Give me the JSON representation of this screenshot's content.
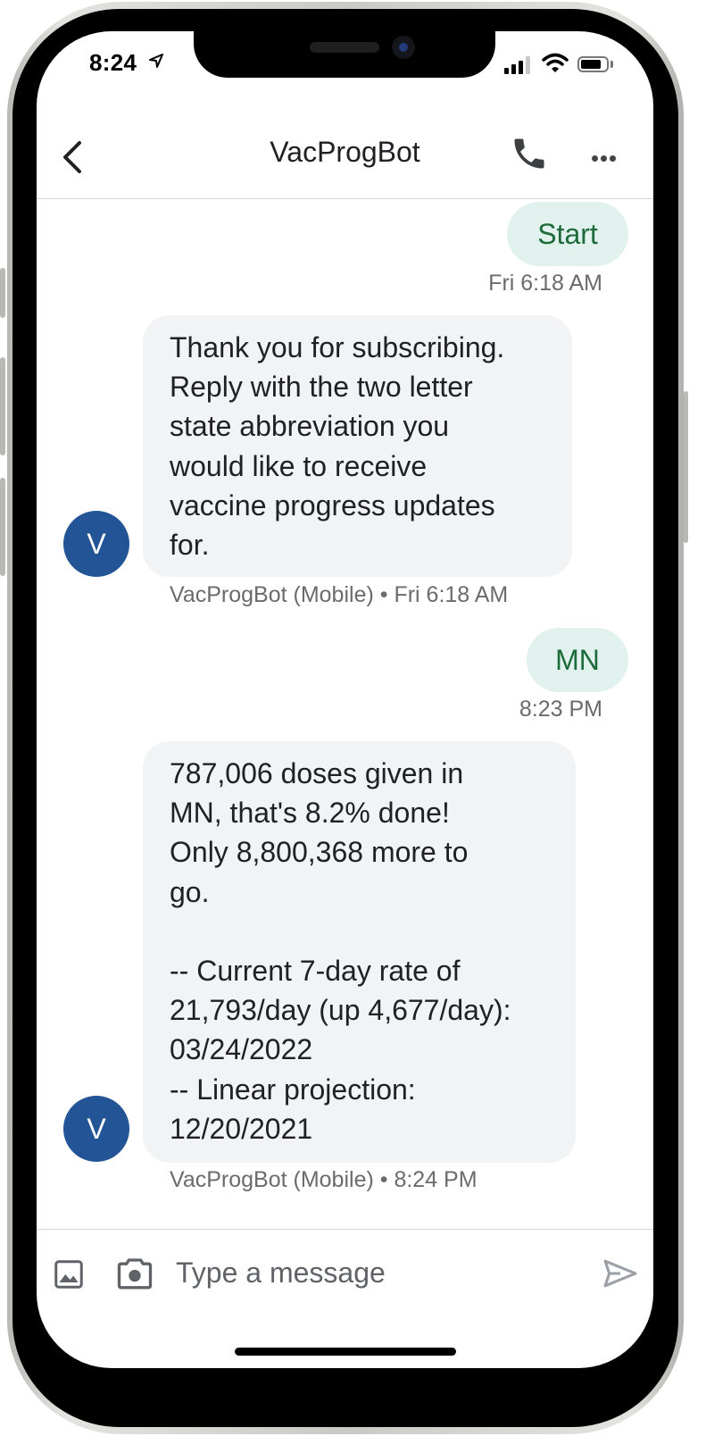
{
  "status_bar": {
    "time": "8:24"
  },
  "header": {
    "title": "VacProgBot",
    "back_icon": "chevron-left-icon",
    "call_icon": "phone-icon",
    "more_icon": "more-horiz-icon"
  },
  "messages": [
    {
      "direction": "outgoing",
      "text": "Start",
      "meta": "Fri 6:18 AM"
    },
    {
      "direction": "incoming",
      "avatar": "V",
      "text": "Thank you for subscribing.\nReply with the two letter\nstate abbreviation you\nwould like to receive\nvaccine progress updates\nfor.",
      "meta": "VacProgBot (Mobile) • Fri 6:18 AM"
    },
    {
      "direction": "outgoing",
      "text": "MN",
      "meta": "8:23 PM"
    },
    {
      "direction": "incoming",
      "avatar": "V",
      "text": "787,006 doses given in\nMN, that's 8.2% done!\nOnly 8,800,368 more to\ngo.\n\n-- Current 7-day rate of\n21,793/day (up 4,677/day):\n03/24/2022\n-- Linear projection:\n12/20/2021",
      "meta": "VacProgBot (Mobile) • 8:24 PM"
    }
  ],
  "composer": {
    "placeholder": "Type a message",
    "gallery_icon": "image-icon",
    "camera_icon": "camera-icon",
    "send_icon": "send-icon"
  },
  "colors": {
    "outgoing_bubble": "#e1f1ee",
    "outgoing_text": "#1d6b3a",
    "incoming_bubble": "#f1f3f4",
    "avatar": "#235596"
  }
}
